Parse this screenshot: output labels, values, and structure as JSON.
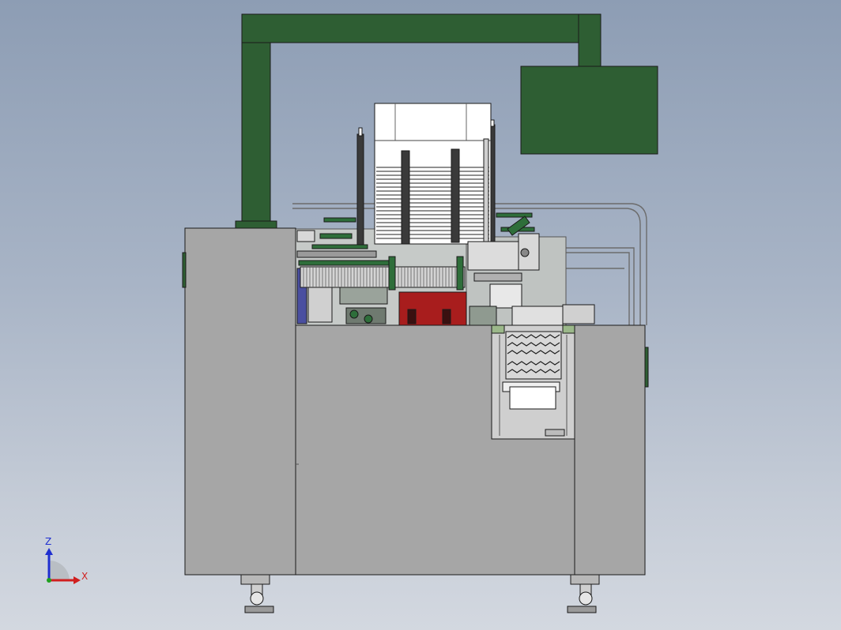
{
  "viewport": {
    "background_top": "#8d9db4",
    "background_bottom": "#d3d8e0"
  },
  "model": {
    "frame_color": "#2e5e33",
    "cabinet_color": "#a6a6a6",
    "accent_red": "#a81d1d",
    "edge_color": "#1a1a1a"
  },
  "triad": {
    "z_label": "Z",
    "x_label": "X",
    "z_color": "#1f2fd0",
    "x_color": "#d01f1f",
    "y_color": "#1fa01f"
  }
}
